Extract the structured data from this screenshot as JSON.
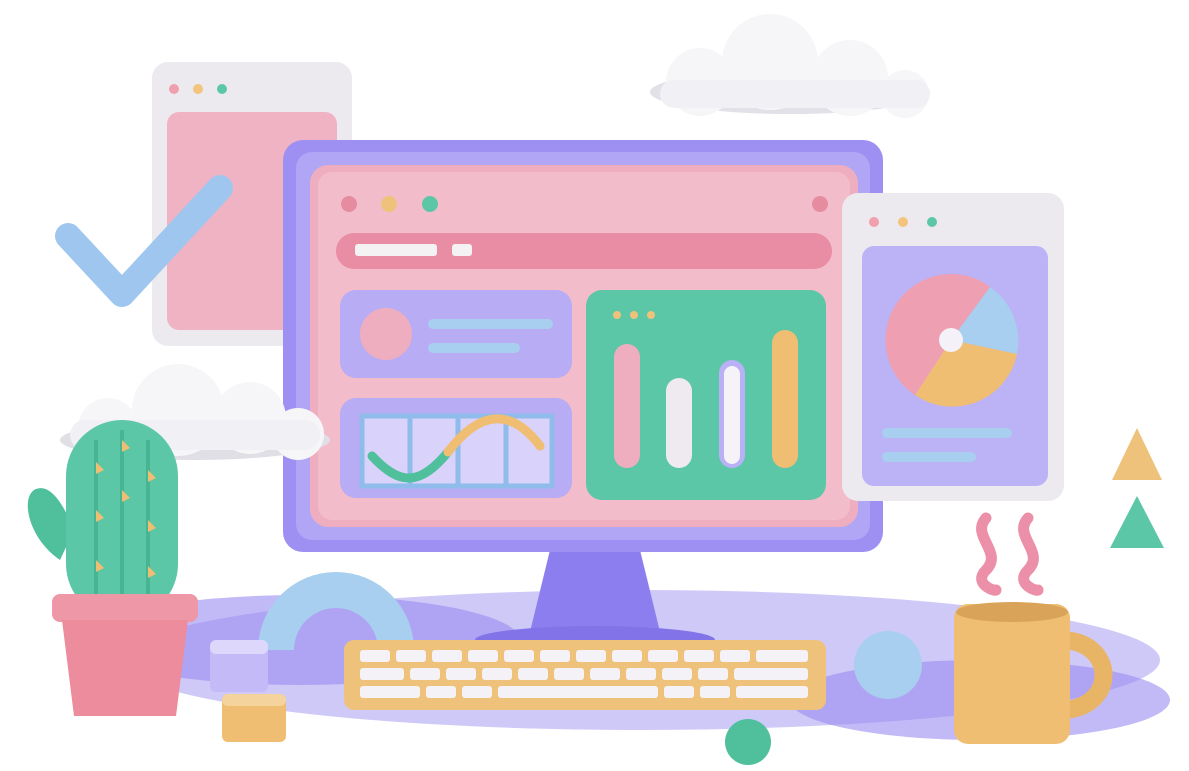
{
  "scene": {
    "colors": {
      "purple": "#9a8cf0",
      "purple_light": "#b9b0f6",
      "lavender": "#c6c0f5",
      "pink": "#eeaec0",
      "pink_light": "#f3c3cf",
      "green": "#5cc7a6",
      "blue": "#a8cff0",
      "orange": "#efc27c",
      "grey": "#e8e6ec",
      "white": "#fafafa"
    },
    "items": [
      {
        "name": "cloud-top-right"
      },
      {
        "name": "cloud-left"
      },
      {
        "name": "back-window"
      },
      {
        "name": "checkmark-icon"
      },
      {
        "name": "monitor"
      },
      {
        "name": "browser-window"
      },
      {
        "name": "bar-chart-panel"
      },
      {
        "name": "line-chart-panel"
      },
      {
        "name": "profile-card"
      },
      {
        "name": "pie-chart-window"
      },
      {
        "name": "keyboard"
      },
      {
        "name": "cactus-plant"
      },
      {
        "name": "coffee-mug"
      },
      {
        "name": "steam-icon"
      },
      {
        "name": "arch-shape"
      },
      {
        "name": "cubes"
      },
      {
        "name": "sphere-blue"
      },
      {
        "name": "sphere-green"
      },
      {
        "name": "cone-orange"
      },
      {
        "name": "cone-green"
      }
    ]
  }
}
